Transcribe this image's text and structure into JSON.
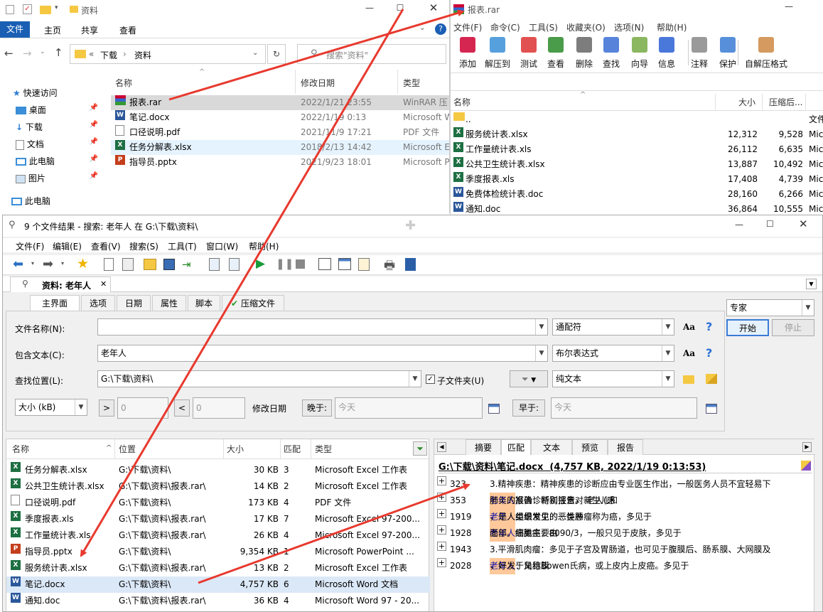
{
  "explorer": {
    "title": "资料",
    "ribbon_tabs": [
      "文件",
      "主页",
      "共享",
      "查看"
    ],
    "address": {
      "prefix": "«",
      "parts": [
        "下载",
        "资料"
      ]
    },
    "search_placeholder": "搜索\"资料\"",
    "nav": [
      {
        "label": "快速访问",
        "icon": "star-icon"
      },
      {
        "label": "桌面",
        "icon": "desktop-icon"
      },
      {
        "label": "下载",
        "icon": "download-icon"
      },
      {
        "label": "文档",
        "icon": "document-icon"
      },
      {
        "label": "此电脑",
        "icon": "computer-icon"
      },
      {
        "label": "图片",
        "icon": "picture-icon"
      },
      {
        "label": "此电脑",
        "icon": "computer-icon"
      }
    ],
    "columns": [
      "名称",
      "修改日期",
      "类型"
    ],
    "files": [
      {
        "name": "报表.rar",
        "date": "2022/1/21 23:55",
        "type": "WinRAR 压",
        "icon": "rar"
      },
      {
        "name": "笔记.docx",
        "date": "2022/1/19 0:13",
        "type": "Microsoft W",
        "icon": "doc"
      },
      {
        "name": "口径说明.pdf",
        "date": "2021/11/9 17:21",
        "type": "PDF 文件",
        "icon": "pdf"
      },
      {
        "name": "任务分解表.xlsx",
        "date": "2018/2/13 14:42",
        "type": "Microsoft E",
        "icon": "xls"
      },
      {
        "name": "指导员.pptx",
        "date": "2021/9/23 18:01",
        "type": "Microsoft P",
        "icon": "ppt"
      }
    ]
  },
  "winrar": {
    "title": "报表.rar",
    "menu": [
      "文件(F)",
      "命令(C)",
      "工具(S)",
      "收藏夹(O)",
      "选项(N)",
      "帮助(H)"
    ],
    "toolbar": [
      "添加",
      "解压到",
      "测试",
      "查看",
      "删除",
      "查找",
      "向导",
      "信息",
      "注释",
      "保护",
      "自解压格式"
    ],
    "columns": [
      "名称",
      "大小",
      "压缩后...",
      ""
    ],
    "files": [
      {
        "name": "..",
        "size": "",
        "packed": "",
        "type": "文件",
        "icon": "folder"
      },
      {
        "name": "服务统计表.xlsx",
        "size": "12,312",
        "packed": "9,528",
        "type": "Mic",
        "icon": "xls"
      },
      {
        "name": "工作量统计表.xls",
        "size": "26,112",
        "packed": "6,635",
        "type": "Mic",
        "icon": "xls"
      },
      {
        "name": "公共卫生统计表.xlsx",
        "size": "13,887",
        "packed": "10,492",
        "type": "Mic",
        "icon": "xls"
      },
      {
        "name": "季度报表.xls",
        "size": "17,408",
        "packed": "4,739",
        "type": "Mic",
        "icon": "xls"
      },
      {
        "name": "免费体检统计表.doc",
        "size": "28,160",
        "packed": "6,266",
        "type": "Mic",
        "icon": "doc"
      },
      {
        "name": "通知.doc",
        "size": "36,864",
        "packed": "10,555",
        "type": "Mic",
        "icon": "doc"
      }
    ]
  },
  "search": {
    "title": "9 个文件结果 - 搜索: 老年人 在 G:\\下载\\资料\\",
    "menu": [
      "文件(F)",
      "编辑(E)",
      "查看(V)",
      "搜索(S)",
      "工具(T)",
      "窗口(W)",
      "帮助(H)"
    ],
    "doc_tab": "资料: 老年人",
    "tabs": [
      "主界面",
      "选项",
      "日期",
      "属性",
      "脚本",
      "压缩文件"
    ],
    "filename_label": "文件名称(N):",
    "filename_value": "",
    "filename_mode": "通配符",
    "content_label": "包含文本(C):",
    "content_value": "老年人",
    "content_mode": "布尔表达式",
    "location_label": "查找位置(L):",
    "location_value": "G:\\下载\\资料\\",
    "subfolder_label": "子文件夹(U)",
    "text_mode": "纯文本",
    "size_select": "大小 (kB)",
    "size_gt": ">",
    "size_lt": "<",
    "size_min": "0",
    "size_max": "0",
    "modify_date_label": "修改日期",
    "after_label": "晚于:",
    "after_value": "今天",
    "before_label": "早于:",
    "before_value": "今天",
    "mode_select": "专家",
    "start_button": "开始",
    "stop_button": "停止",
    "aa": "Aa",
    "help": "?",
    "result_columns": [
      "名称",
      "位置",
      "大小",
      "匹配",
      "类型"
    ],
    "results": [
      {
        "name": "任务分解表.xlsx",
        "loc": "G:\\下载\\资料\\",
        "size": "30 KB",
        "match": "3",
        "type": "Microsoft Excel 工作表",
        "icon": "xls"
      },
      {
        "name": "公共卫生统计表.xlsx",
        "loc": "G:\\下载\\资料\\报表.rar\\",
        "size": "14 KB",
        "match": "2",
        "type": "Microsoft Excel 工作表",
        "icon": "xls"
      },
      {
        "name": "口径说明.pdf",
        "loc": "G:\\下载\\资料\\",
        "size": "173 KB",
        "match": "4",
        "type": "PDF 文件",
        "icon": "pdf"
      },
      {
        "name": "季度报表.xls",
        "loc": "G:\\下载\\资料\\报表.rar\\",
        "size": "17 KB",
        "match": "7",
        "type": "Microsoft Excel 97-200...",
        "icon": "xls"
      },
      {
        "name": "工作量统计表.xls",
        "loc": "G:\\下载\\资料\\报表.rar\\",
        "size": "26 KB",
        "match": "4",
        "type": "Microsoft Excel 97-200...",
        "icon": "xls"
      },
      {
        "name": "指导员.pptx",
        "loc": "G:\\下载\\资料\\",
        "size": "9,354 KB",
        "match": "1",
        "type": "Microsoft PowerPoint ...",
        "icon": "ppt"
      },
      {
        "name": "服务统计表.xlsx",
        "loc": "G:\\下载\\资料\\报表.rar\\",
        "size": "13 KB",
        "match": "2",
        "type": "Microsoft Excel 工作表",
        "icon": "xls"
      },
      {
        "name": "笔记.docx",
        "loc": "G:\\下载\\资料\\",
        "size": "4,757 KB",
        "match": "6",
        "type": "Microsoft Word 文档",
        "icon": "doc"
      },
      {
        "name": "通知.doc",
        "loc": "G:\\下载\\资料\\报表.rar\\",
        "size": "36 KB",
        "match": "4",
        "type": "Microsoft Word 97 - 20...",
        "icon": "doc"
      }
    ],
    "preview_tabs": [
      "摘要",
      "匹配",
      "文本",
      "预览",
      "报告"
    ],
    "preview_header": "G:\\下载\\资料\\笔记.docx  (4,757 KB, 2022/1/19 0:13:53)",
    "matches": [
      {
        "line": "323",
        "pre": "3.精神疾患：精神疾患的诊断应由专业医生作出，一般医务人员不宜轻易下",
        "hit": "",
        "post": ""
      },
      {
        "line": "353",
        "pre": "肺炎的报告：特别注意对新生儿和",
        "hit": "老年人",
        "post": "肺炎的准确诊断和报告。 老人(感"
      },
      {
        "line": "1919",
        "pre": "由上皮组织发生的恶性肿瘤称为癌，多见于",
        "hit": "老年人",
        "post": "，是人类最常见的一类恶"
      },
      {
        "line": "1928",
        "pre": "3.基底细胞癌：8090/3，一般只见于皮肤，多见于",
        "hit": "老年人",
        "post": "面部。癌巢主要由"
      },
      {
        "line": "1943",
        "pre": "3.平滑肌肉瘤：多见于子宫及胃肠道，也可见于腹膜后、肠系膜、大网膜及",
        "hit": "",
        "post": ""
      },
      {
        "line": "2028",
        "pre": "原位癌：又称Bowen氏病，或上皮内上皮癌。多见于",
        "hit": "老年人",
        "post": "，好发于角结膜"
      }
    ]
  }
}
